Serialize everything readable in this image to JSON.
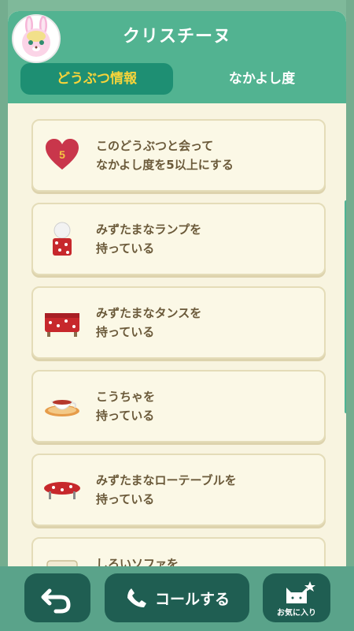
{
  "header": {
    "title": "クリスチーヌ",
    "tabs": [
      {
        "label": "どうぶつ情報",
        "active": true
      },
      {
        "label": "なかよし度",
        "active": false
      }
    ]
  },
  "cards": [
    {
      "line1": "このどうぶつと会って",
      "line2": "なかよし度を5以上にする",
      "icon": "heart-icon",
      "heart_number": "5"
    },
    {
      "line1": "みずたまなランプを",
      "line2": "持っている",
      "icon": "lamp-icon"
    },
    {
      "line1": "みずたまなタンスを",
      "line2": "持っている",
      "icon": "dresser-icon"
    },
    {
      "line1": "こうちゃを",
      "line2": "持っている",
      "icon": "tea-cup-icon"
    },
    {
      "line1": "みずたまなローテーブルを",
      "line2": "持っている",
      "icon": "low-table-icon"
    },
    {
      "line1": "しろいソファを",
      "line2": "",
      "icon": "sofa-icon"
    }
  ],
  "bottom": {
    "call_label": "コールする",
    "favorite_label": "お気に入り"
  },
  "colors": {
    "header": "#52b391",
    "tab_active_bg": "#1e8f73",
    "tab_active_text": "#f7d43a",
    "card_bg": "#fbf8e6",
    "text": "#6b5a3a",
    "bottom_button": "#1f5e52"
  }
}
